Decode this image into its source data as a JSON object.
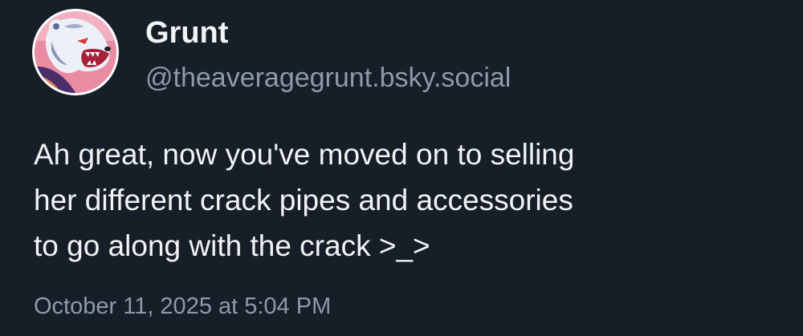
{
  "author": {
    "display_name": "Grunt",
    "handle": "@theaveragegrunt.bsky.social",
    "avatar_icon": "polar-bear-avatar"
  },
  "post": {
    "text_lines": [
      "Ah great, now you've moved on to selling",
      "her different crack pipes and accessories",
      "to go along with the crack >_>"
    ],
    "timestamp": "October 11, 2025 at 5:04 PM"
  },
  "colors": {
    "background": "#161e27",
    "primary_text": "#f1f3f5",
    "secondary_text": "#8d9aab",
    "avatar_ring": "#ffffff",
    "avatar_bg_pink": "#e98ba3",
    "avatar_fur_shade": "#5f6c9c"
  }
}
